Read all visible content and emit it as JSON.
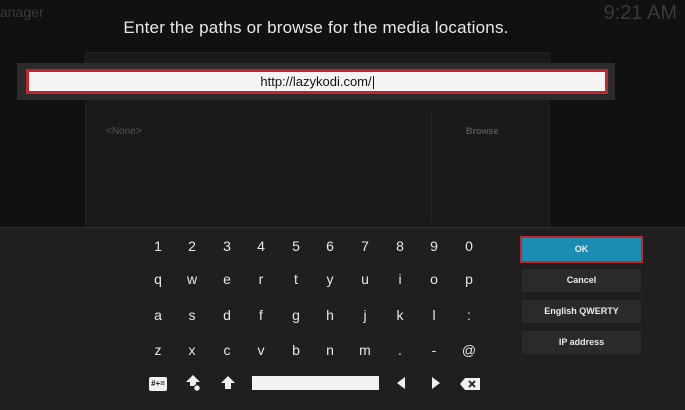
{
  "background": {
    "corner_left": "anager",
    "corner_right": "9:21 AM",
    "none_label": "<None>",
    "browse_label": "Browse"
  },
  "dialog": {
    "title": "Enter the paths or browse for the media locations.",
    "input_value": "http://lazykodi.com/"
  },
  "keyboard": {
    "rows": [
      [
        "1",
        "2",
        "3",
        "4",
        "5",
        "6",
        "7",
        "8",
        "9",
        "0"
      ],
      [
        "q",
        "w",
        "e",
        "r",
        "t",
        "y",
        "u",
        "i",
        "o",
        "p"
      ],
      [
        "a",
        "s",
        "d",
        "f",
        "g",
        "h",
        "j",
        "k",
        "l",
        ":"
      ],
      [
        "z",
        "x",
        "c",
        "v",
        "b",
        "n",
        "m",
        ".",
        "-",
        "@"
      ]
    ],
    "symbols_label": "#+="
  },
  "buttons": {
    "ok": "OK",
    "cancel": "Cancel",
    "layout": "English QWERTY",
    "ip": "IP address"
  },
  "colors": {
    "accent": "#1b8db3",
    "highlight_border": "#c1272d"
  }
}
